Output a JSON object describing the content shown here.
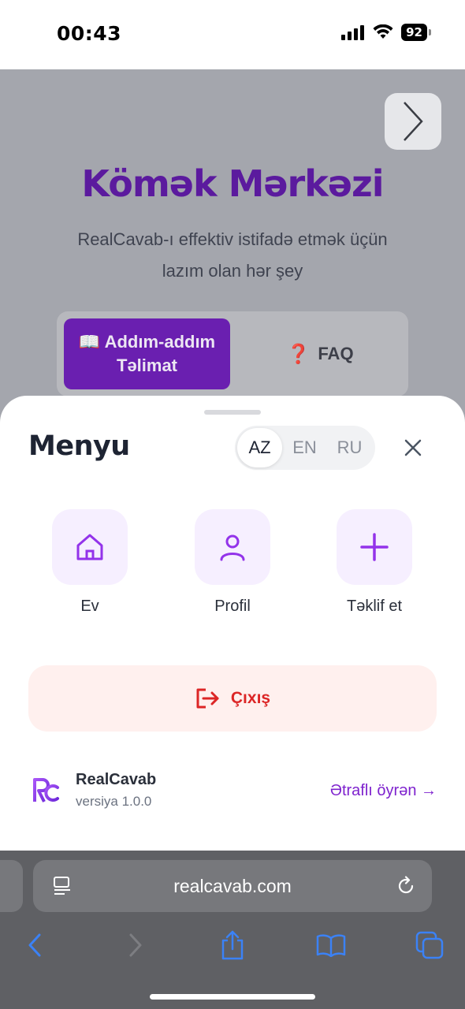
{
  "status_bar": {
    "time": "00:43",
    "battery": "92"
  },
  "page": {
    "title": "Kömək Mərkəzi",
    "subtitle": "RealCavab-ı effektiv istifadə etmək üçün lazım olan hər şey",
    "tabs": [
      {
        "icon": "📖",
        "label": "Addım-addım Təlimat",
        "active": true
      },
      {
        "icon": "❓",
        "label": "FAQ",
        "active": false
      }
    ]
  },
  "menu": {
    "title": "Menyu",
    "languages": [
      "AZ",
      "EN",
      "RU"
    ],
    "active_language": "AZ",
    "nav_items": [
      {
        "icon": "home-icon",
        "label": "Ev"
      },
      {
        "icon": "user-icon",
        "label": "Profil"
      },
      {
        "icon": "plus-icon",
        "label": "Təklif et"
      }
    ],
    "logout_label": "Çıxış",
    "app": {
      "name": "RealCavab",
      "version": "versiya 1.0.0",
      "learn_more": "Ətraflı öyrən →"
    }
  },
  "browser": {
    "url": "realcavab.com"
  },
  "colors": {
    "accent": "#7e22ce",
    "danger": "#dc2626",
    "title_purple": "#5b1a9e"
  }
}
